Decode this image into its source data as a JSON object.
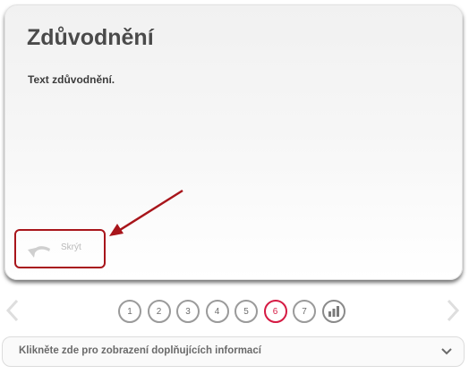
{
  "card": {
    "title": "Zdůvodnění",
    "body_text": "Text zdůvodnění.",
    "hide_label": "Skrýt"
  },
  "pager": {
    "pages": [
      "1",
      "2",
      "3",
      "4",
      "5",
      "6",
      "7"
    ],
    "active_page": "6"
  },
  "info_bar": {
    "text": "Klikněte zde pro zobrazení doplňujících informací"
  },
  "colors": {
    "highlight": "#a8151b",
    "active_page": "#d51a43"
  },
  "icons": {
    "hide": "undo-arrow-icon",
    "prev": "chevron-left-icon",
    "next": "chevron-right-icon",
    "stats": "bar-chart-icon",
    "expand": "chevron-down-icon"
  }
}
